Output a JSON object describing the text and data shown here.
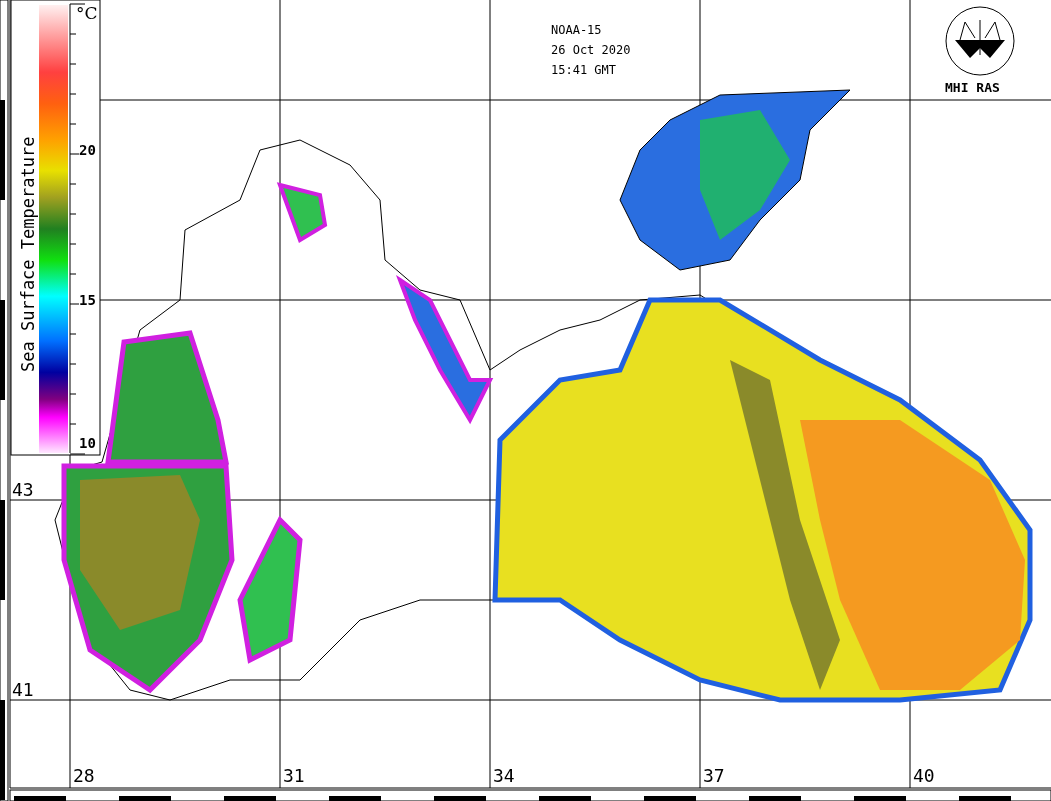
{
  "colorbar": {
    "title": "Sea Surface Temperature",
    "unit": "°C",
    "ticks": [
      "20",
      "15",
      "10"
    ]
  },
  "header": {
    "satellite": "NOAA-15",
    "date": "26 Oct 2020",
    "time": "15:41 GMT"
  },
  "logo": {
    "text": "MHI RAS"
  },
  "latitude_labels": [
    "43",
    "41"
  ],
  "longitude_labels": [
    "28",
    "31",
    "34",
    "37",
    "40"
  ]
}
